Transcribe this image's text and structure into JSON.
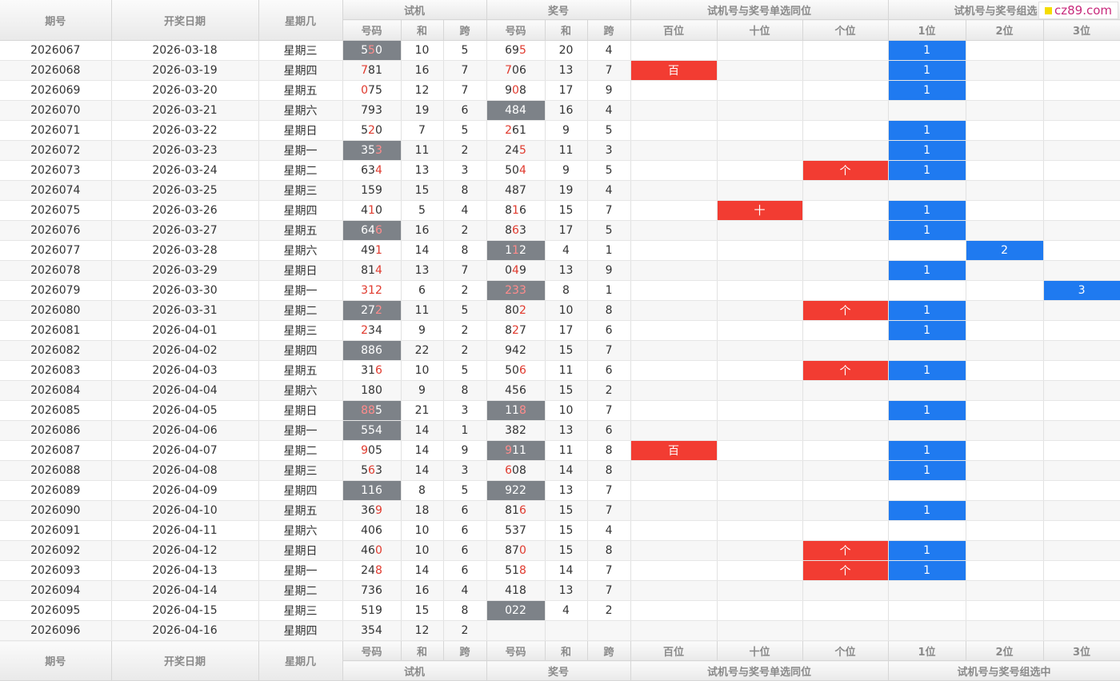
{
  "headers": {
    "qihao": "期号",
    "date": "开奖日期",
    "weekday": "星期几",
    "shiji": "试机",
    "jianghao": "奖号",
    "same_pos_group": "试机号与奖号单选同位",
    "group_sel_group_top": "试机号与奖号组选",
    "group_sel_group": "试机号与奖号组选中",
    "haoma": "号码",
    "he": "和",
    "kua": "跨",
    "bai": "百位",
    "shi": "十位",
    "ge": "个位",
    "p1": "1位",
    "p2": "2位",
    "p3": "3位"
  },
  "logo_text": "cz89.com",
  "rows": [
    {
      "period": "2026067",
      "date": "2026-03-18",
      "weekday": "星期三",
      "trial": "550",
      "trial_hl": [
        false,
        true,
        false
      ],
      "trial_gray": true,
      "trial_sum": "10",
      "trial_span": "5",
      "draw": "695",
      "draw_hl": [
        false,
        false,
        true
      ],
      "draw_gray": false,
      "draw_sum": "20",
      "draw_span": "4",
      "same": "",
      "group": "1"
    },
    {
      "period": "2026068",
      "date": "2026-03-19",
      "weekday": "星期四",
      "trial": "781",
      "trial_hl": [
        true,
        false,
        false
      ],
      "trial_gray": false,
      "trial_sum": "16",
      "trial_span": "7",
      "draw": "706",
      "draw_hl": [
        true,
        false,
        false
      ],
      "draw_gray": false,
      "draw_sum": "13",
      "draw_span": "7",
      "same": "百",
      "group": "1"
    },
    {
      "period": "2026069",
      "date": "2026-03-20",
      "weekday": "星期五",
      "trial": "075",
      "trial_hl": [
        true,
        false,
        false
      ],
      "trial_gray": false,
      "trial_sum": "12",
      "trial_span": "7",
      "draw": "908",
      "draw_hl": [
        false,
        true,
        false
      ],
      "draw_gray": false,
      "draw_sum": "17",
      "draw_span": "9",
      "same": "",
      "group": "1"
    },
    {
      "period": "2026070",
      "date": "2026-03-21",
      "weekday": "星期六",
      "trial": "793",
      "trial_hl": [
        false,
        false,
        false
      ],
      "trial_gray": false,
      "trial_sum": "19",
      "trial_span": "6",
      "draw": "484",
      "draw_hl": [
        false,
        false,
        false
      ],
      "draw_gray": true,
      "draw_sum": "16",
      "draw_span": "4",
      "same": "",
      "group": ""
    },
    {
      "period": "2026071",
      "date": "2026-03-22",
      "weekday": "星期日",
      "trial": "520",
      "trial_hl": [
        false,
        true,
        false
      ],
      "trial_gray": false,
      "trial_sum": "7",
      "trial_span": "5",
      "draw": "261",
      "draw_hl": [
        true,
        false,
        false
      ],
      "draw_gray": false,
      "draw_sum": "9",
      "draw_span": "5",
      "same": "",
      "group": "1"
    },
    {
      "period": "2026072",
      "date": "2026-03-23",
      "weekday": "星期一",
      "trial": "353",
      "trial_hl": [
        false,
        false,
        true
      ],
      "trial_gray": true,
      "trial_sum": "11",
      "trial_span": "2",
      "draw": "245",
      "draw_hl": [
        false,
        false,
        true
      ],
      "draw_gray": false,
      "draw_sum": "11",
      "draw_span": "3",
      "same": "",
      "group": "1"
    },
    {
      "period": "2026073",
      "date": "2026-03-24",
      "weekday": "星期二",
      "trial": "634",
      "trial_hl": [
        false,
        false,
        true
      ],
      "trial_gray": false,
      "trial_sum": "13",
      "trial_span": "3",
      "draw": "504",
      "draw_hl": [
        false,
        false,
        true
      ],
      "draw_gray": false,
      "draw_sum": "9",
      "draw_span": "5",
      "same": "个",
      "group": "1"
    },
    {
      "period": "2026074",
      "date": "2026-03-25",
      "weekday": "星期三",
      "trial": "159",
      "trial_hl": [
        false,
        false,
        false
      ],
      "trial_gray": false,
      "trial_sum": "15",
      "trial_span": "8",
      "draw": "487",
      "draw_hl": [
        false,
        false,
        false
      ],
      "draw_gray": false,
      "draw_sum": "19",
      "draw_span": "4",
      "same": "",
      "group": ""
    },
    {
      "period": "2026075",
      "date": "2026-03-26",
      "weekday": "星期四",
      "trial": "410",
      "trial_hl": [
        false,
        true,
        false
      ],
      "trial_gray": false,
      "trial_sum": "5",
      "trial_span": "4",
      "draw": "816",
      "draw_hl": [
        false,
        true,
        false
      ],
      "draw_gray": false,
      "draw_sum": "15",
      "draw_span": "7",
      "same": "十",
      "group": "1"
    },
    {
      "period": "2026076",
      "date": "2026-03-27",
      "weekday": "星期五",
      "trial": "646",
      "trial_hl": [
        false,
        false,
        true
      ],
      "trial_gray": true,
      "trial_sum": "16",
      "trial_span": "2",
      "draw": "863",
      "draw_hl": [
        false,
        true,
        false
      ],
      "draw_gray": false,
      "draw_sum": "17",
      "draw_span": "5",
      "same": "",
      "group": "1"
    },
    {
      "period": "2026077",
      "date": "2026-03-28",
      "weekday": "星期六",
      "trial": "491",
      "trial_hl": [
        false,
        false,
        true
      ],
      "trial_gray": false,
      "trial_sum": "14",
      "trial_span": "8",
      "draw": "112",
      "draw_hl": [
        false,
        true,
        false
      ],
      "draw_gray": true,
      "draw_sum": "4",
      "draw_span": "1",
      "same": "",
      "group": "2"
    },
    {
      "period": "2026078",
      "date": "2026-03-29",
      "weekday": "星期日",
      "trial": "814",
      "trial_hl": [
        false,
        false,
        true
      ],
      "trial_gray": false,
      "trial_sum": "13",
      "trial_span": "7",
      "draw": "049",
      "draw_hl": [
        false,
        true,
        false
      ],
      "draw_gray": false,
      "draw_sum": "13",
      "draw_span": "9",
      "same": "",
      "group": "1"
    },
    {
      "period": "2026079",
      "date": "2026-03-30",
      "weekday": "星期一",
      "trial": "312",
      "trial_hl": [
        true,
        true,
        true
      ],
      "trial_gray": false,
      "trial_sum": "6",
      "trial_span": "2",
      "draw": "233",
      "draw_hl": [
        true,
        true,
        true
      ],
      "draw_gray": true,
      "draw_sum": "8",
      "draw_span": "1",
      "same": "",
      "group": "3"
    },
    {
      "period": "2026080",
      "date": "2026-03-31",
      "weekday": "星期二",
      "trial": "272",
      "trial_hl": [
        false,
        false,
        true
      ],
      "trial_gray": true,
      "trial_sum": "11",
      "trial_span": "5",
      "draw": "802",
      "draw_hl": [
        false,
        false,
        true
      ],
      "draw_gray": false,
      "draw_sum": "10",
      "draw_span": "8",
      "same": "个",
      "group": "1"
    },
    {
      "period": "2026081",
      "date": "2026-04-01",
      "weekday": "星期三",
      "trial": "234",
      "trial_hl": [
        true,
        false,
        false
      ],
      "trial_gray": false,
      "trial_sum": "9",
      "trial_span": "2",
      "draw": "827",
      "draw_hl": [
        false,
        true,
        false
      ],
      "draw_gray": false,
      "draw_sum": "17",
      "draw_span": "6",
      "same": "",
      "group": "1"
    },
    {
      "period": "2026082",
      "date": "2026-04-02",
      "weekday": "星期四",
      "trial": "886",
      "trial_hl": [
        false,
        false,
        false
      ],
      "trial_gray": true,
      "trial_sum": "22",
      "trial_span": "2",
      "draw": "942",
      "draw_hl": [
        false,
        false,
        false
      ],
      "draw_gray": false,
      "draw_sum": "15",
      "draw_span": "7",
      "same": "",
      "group": ""
    },
    {
      "period": "2026083",
      "date": "2026-04-03",
      "weekday": "星期五",
      "trial": "316",
      "trial_hl": [
        false,
        false,
        true
      ],
      "trial_gray": false,
      "trial_sum": "10",
      "trial_span": "5",
      "draw": "506",
      "draw_hl": [
        false,
        false,
        true
      ],
      "draw_gray": false,
      "draw_sum": "11",
      "draw_span": "6",
      "same": "个",
      "group": "1"
    },
    {
      "period": "2026084",
      "date": "2026-04-04",
      "weekday": "星期六",
      "trial": "180",
      "trial_hl": [
        false,
        false,
        false
      ],
      "trial_gray": false,
      "trial_sum": "9",
      "trial_span": "8",
      "draw": "456",
      "draw_hl": [
        false,
        false,
        false
      ],
      "draw_gray": false,
      "draw_sum": "15",
      "draw_span": "2",
      "same": "",
      "group": ""
    },
    {
      "period": "2026085",
      "date": "2026-04-05",
      "weekday": "星期日",
      "trial": "885",
      "trial_hl": [
        true,
        true,
        false
      ],
      "trial_gray": true,
      "trial_sum": "21",
      "trial_span": "3",
      "draw": "118",
      "draw_hl": [
        false,
        false,
        true
      ],
      "draw_gray": true,
      "draw_sum": "10",
      "draw_span": "7",
      "same": "",
      "group": "1"
    },
    {
      "period": "2026086",
      "date": "2026-04-06",
      "weekday": "星期一",
      "trial": "554",
      "trial_hl": [
        false,
        false,
        false
      ],
      "trial_gray": true,
      "trial_sum": "14",
      "trial_span": "1",
      "draw": "382",
      "draw_hl": [
        false,
        false,
        false
      ],
      "draw_gray": false,
      "draw_sum": "13",
      "draw_span": "6",
      "same": "",
      "group": ""
    },
    {
      "period": "2026087",
      "date": "2026-04-07",
      "weekday": "星期二",
      "trial": "905",
      "trial_hl": [
        true,
        false,
        false
      ],
      "trial_gray": false,
      "trial_sum": "14",
      "trial_span": "9",
      "draw": "911",
      "draw_hl": [
        true,
        false,
        false
      ],
      "draw_gray": true,
      "draw_sum": "11",
      "draw_span": "8",
      "same": "百",
      "group": "1"
    },
    {
      "period": "2026088",
      "date": "2026-04-08",
      "weekday": "星期三",
      "trial": "563",
      "trial_hl": [
        false,
        true,
        false
      ],
      "trial_gray": false,
      "trial_sum": "14",
      "trial_span": "3",
      "draw": "608",
      "draw_hl": [
        true,
        false,
        false
      ],
      "draw_gray": false,
      "draw_sum": "14",
      "draw_span": "8",
      "same": "",
      "group": "1"
    },
    {
      "period": "2026089",
      "date": "2026-04-09",
      "weekday": "星期四",
      "trial": "116",
      "trial_hl": [
        false,
        false,
        false
      ],
      "trial_gray": true,
      "trial_sum": "8",
      "trial_span": "5",
      "draw": "922",
      "draw_hl": [
        false,
        false,
        false
      ],
      "draw_gray": true,
      "draw_sum": "13",
      "draw_span": "7",
      "same": "",
      "group": ""
    },
    {
      "period": "2026090",
      "date": "2026-04-10",
      "weekday": "星期五",
      "trial": "369",
      "trial_hl": [
        false,
        false,
        true
      ],
      "trial_gray": false,
      "trial_sum": "18",
      "trial_span": "6",
      "draw": "816",
      "draw_hl": [
        false,
        false,
        true
      ],
      "draw_gray": false,
      "draw_sum": "15",
      "draw_span": "7",
      "same": "",
      "group": "1"
    },
    {
      "period": "2026091",
      "date": "2026-04-11",
      "weekday": "星期六",
      "trial": "406",
      "trial_hl": [
        false,
        false,
        false
      ],
      "trial_gray": false,
      "trial_sum": "10",
      "trial_span": "6",
      "draw": "537",
      "draw_hl": [
        false,
        false,
        false
      ],
      "draw_gray": false,
      "draw_sum": "15",
      "draw_span": "4",
      "same": "",
      "group": ""
    },
    {
      "period": "2026092",
      "date": "2026-04-12",
      "weekday": "星期日",
      "trial": "460",
      "trial_hl": [
        false,
        false,
        true
      ],
      "trial_gray": false,
      "trial_sum": "10",
      "trial_span": "6",
      "draw": "870",
      "draw_hl": [
        false,
        false,
        true
      ],
      "draw_gray": false,
      "draw_sum": "15",
      "draw_span": "8",
      "same": "个",
      "group": "1"
    },
    {
      "period": "2026093",
      "date": "2026-04-13",
      "weekday": "星期一",
      "trial": "248",
      "trial_hl": [
        false,
        false,
        true
      ],
      "trial_gray": false,
      "trial_sum": "14",
      "trial_span": "6",
      "draw": "518",
      "draw_hl": [
        false,
        false,
        true
      ],
      "draw_gray": false,
      "draw_sum": "14",
      "draw_span": "7",
      "same": "个",
      "group": "1"
    },
    {
      "period": "2026094",
      "date": "2026-04-14",
      "weekday": "星期二",
      "trial": "736",
      "trial_hl": [
        false,
        false,
        false
      ],
      "trial_gray": false,
      "trial_sum": "16",
      "trial_span": "4",
      "draw": "418",
      "draw_hl": [
        false,
        false,
        false
      ],
      "draw_gray": false,
      "draw_sum": "13",
      "draw_span": "7",
      "same": "",
      "group": ""
    },
    {
      "period": "2026095",
      "date": "2026-04-15",
      "weekday": "星期三",
      "trial": "519",
      "trial_hl": [
        false,
        false,
        false
      ],
      "trial_gray": false,
      "trial_sum": "15",
      "trial_span": "8",
      "draw": "022",
      "draw_hl": [
        false,
        false,
        false
      ],
      "draw_gray": true,
      "draw_sum": "4",
      "draw_span": "2",
      "same": "",
      "group": ""
    },
    {
      "period": "2026096",
      "date": "2026-04-16",
      "weekday": "星期四",
      "trial": "354",
      "trial_hl": [
        false,
        false,
        false
      ],
      "trial_gray": false,
      "trial_sum": "12",
      "trial_span": "2",
      "draw": "",
      "draw_hl": [
        false,
        false,
        false
      ],
      "draw_gray": false,
      "draw_sum": "",
      "draw_span": "",
      "same": "",
      "group": ""
    }
  ],
  "colors": {
    "highlight_digit": "#e03a2e",
    "pair_cell": "#7d8288",
    "same_position": "#f23c32",
    "group_position": "#1f7af0"
  }
}
